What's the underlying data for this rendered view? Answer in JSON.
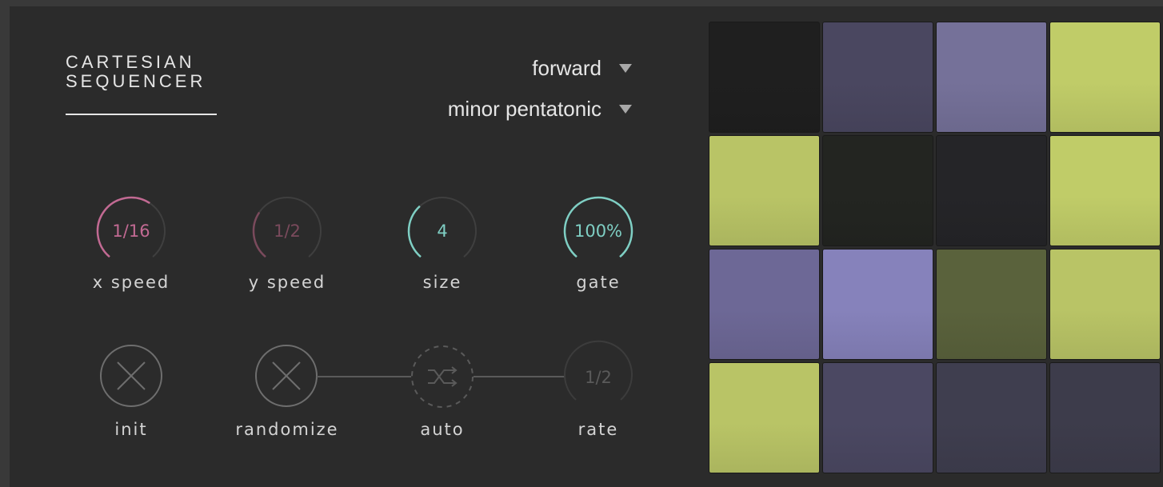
{
  "title": {
    "line1": "CARTESIAN",
    "line2": "SEQUENCER"
  },
  "direction_dropdown": {
    "value": "forward"
  },
  "scale_dropdown": {
    "value": "minor pentatonic"
  },
  "knobs": [
    {
      "label": "x speed",
      "value": "1/16",
      "color": "#c26a93",
      "level": 0.62
    },
    {
      "label": "y speed",
      "value": "1/2",
      "color": "#7a4a5c",
      "level": 0.3
    },
    {
      "label": "size",
      "value": "4",
      "color": "#7fcfc4",
      "level": 0.35
    },
    {
      "label": "gate",
      "value": "100%",
      "color": "#7fcfc4",
      "level": 1.0
    }
  ],
  "buttons": {
    "init": {
      "label": "init",
      "icon": "x-icon"
    },
    "randomize": {
      "label": "randomize",
      "icon": "x-icon"
    },
    "auto": {
      "label": "auto",
      "icon": "shuffle-icon",
      "enabled": false
    },
    "rate": {
      "label": "rate",
      "value": "1/2"
    }
  },
  "colors": {
    "green_accent": "#c2cd6a",
    "purple_accent": "#8a86c8"
  },
  "grid": {
    "rows": 4,
    "cols": 4,
    "cells": [
      [
        "#1f1f1f",
        "#4a4760",
        "#757199",
        "#c0cc68"
      ],
      [
        "#b9c466",
        "#232521",
        "#252528",
        "#c0cc68"
      ],
      [
        "#6d6896",
        "#8682bb",
        "#5a623c",
        "#b9c466"
      ],
      [
        "#b9c466",
        "#4b4862",
        "#3f3e4f",
        "#3d3c4b"
      ]
    ]
  }
}
